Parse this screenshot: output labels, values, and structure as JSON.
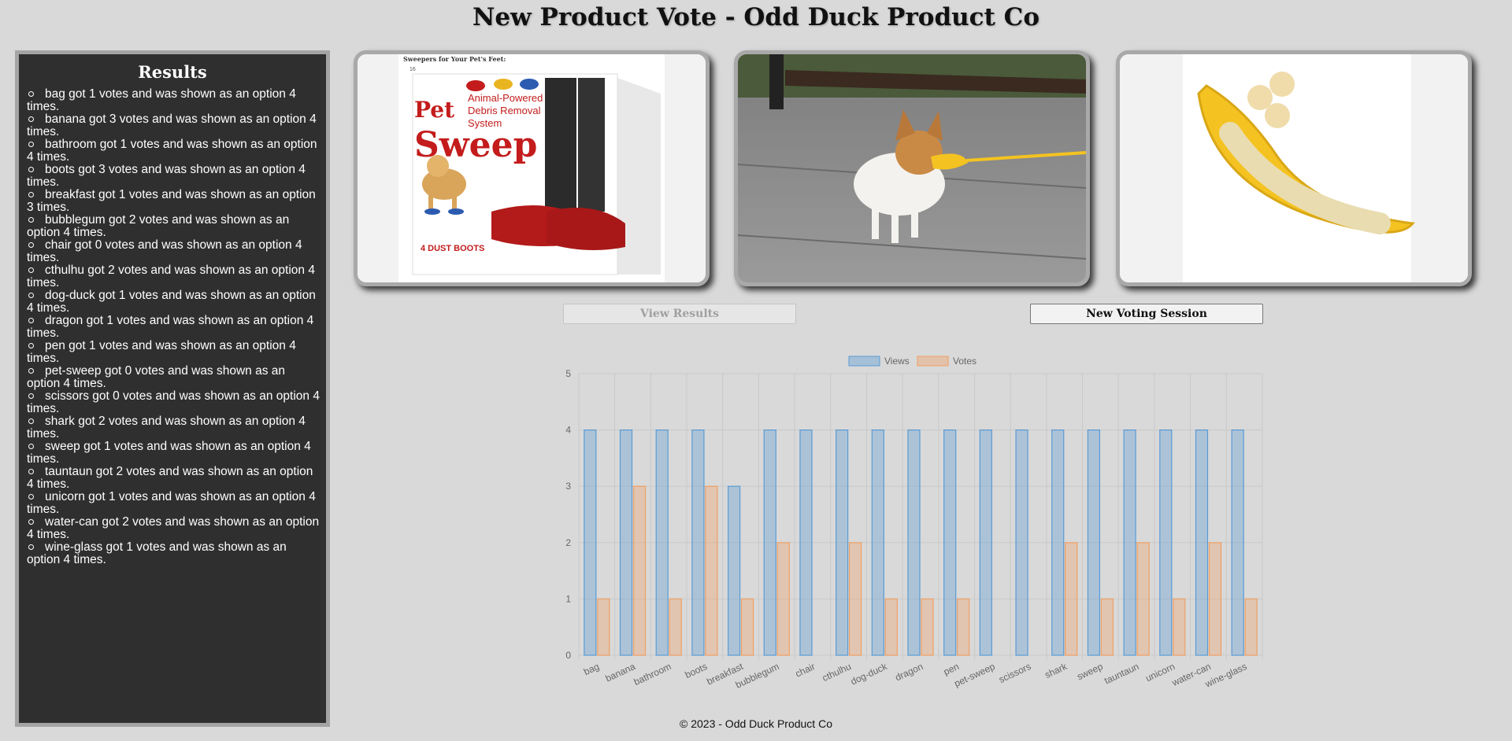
{
  "page": {
    "title": "New Product Vote - Odd Duck Product Co"
  },
  "results": {
    "heading": "Results",
    "items": [
      "bag got 1 votes and was shown as an option 4 times.",
      "banana got 3 votes and was shown as an option 4 times.",
      "bathroom got 1 votes and was shown as an option 4 times.",
      "boots got 3 votes and was shown as an option 4 times.",
      "breakfast got 1 votes and was shown as an option 3 times.",
      "bubblegum got 2 votes and was shown as an option 4 times.",
      "chair got 0 votes and was shown as an option 4 times.",
      "cthulhu got 2 votes and was shown as an option 4 times.",
      "dog-duck got 1 votes and was shown as an option 4 times.",
      "dragon got 1 votes and was shown as an option 4 times.",
      "pen got 1 votes and was shown as an option 4 times.",
      "pet-sweep got 0 votes and was shown as an option 4 times.",
      "scissors got 0 votes and was shown as an option 4 times.",
      "shark got 2 votes and was shown as an option 4 times.",
      "sweep got 1 votes and was shown as an option 4 times.",
      "tauntaun got 2 votes and was shown as an option 4 times.",
      "unicorn got 1 votes and was shown as an option 4 times.",
      "water-can got 2 votes and was shown as an option 4 times.",
      "wine-glass got 1 votes and was shown as an option 4 times."
    ]
  },
  "products": [
    {
      "name": "pet-sweep",
      "header_text": "Sweepers for Your Pet's Feet:",
      "number": "16",
      "brand_line": "Pet Sweep",
      "tagline": "Animal-Powered Debris Removal System",
      "box_caption": "4 DUST BOOTS"
    },
    {
      "name": "dog-duck"
    },
    {
      "name": "banana"
    }
  ],
  "buttons": {
    "view_results": "View Results",
    "new_session": "New Voting Session"
  },
  "chart_data": {
    "type": "bar",
    "categories": [
      "bag",
      "banana",
      "bathroom",
      "boots",
      "breakfast",
      "bubblegum",
      "chair",
      "cthulhu",
      "dog-duck",
      "dragon",
      "pen",
      "pet-sweep",
      "scissors",
      "shark",
      "sweep",
      "tauntaun",
      "unicorn",
      "water-can",
      "wine-glass"
    ],
    "series": [
      {
        "name": "Views",
        "values": [
          4,
          4,
          4,
          4,
          3,
          4,
          4,
          4,
          4,
          4,
          4,
          4,
          4,
          4,
          4,
          4,
          4,
          4,
          4
        ],
        "color": "#5a9bd5"
      },
      {
        "name": "Votes",
        "values": [
          1,
          3,
          1,
          3,
          1,
          2,
          0,
          2,
          1,
          1,
          1,
          0,
          0,
          2,
          1,
          2,
          1,
          2,
          1
        ],
        "color": "#f0a064"
      }
    ],
    "ylim": [
      0,
      5
    ],
    "yticks": [
      0,
      1,
      2,
      3,
      4,
      5
    ],
    "legend": "top",
    "grid": true
  },
  "footer": {
    "text": "© 2023 - Odd Duck Product Co"
  },
  "colors": {
    "background": "#d9d9d9",
    "panel": "#2f2f2f",
    "views": "#5a9bd5",
    "votes": "#f0a064"
  }
}
